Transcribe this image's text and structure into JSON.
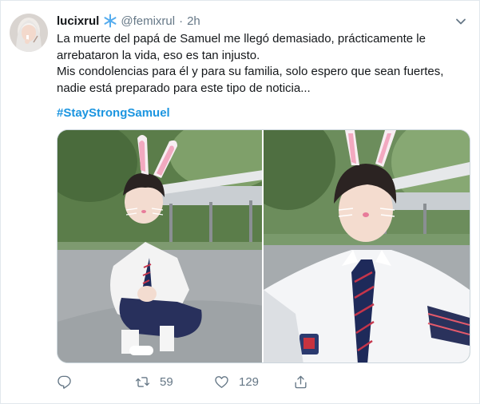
{
  "tweet": {
    "display_name": "lucixrul",
    "handle": "@femixrul",
    "separator": "·",
    "time": "2h",
    "text_lines": [
      "La muerte del papá de Samuel me llegó demasiado, prácticamente le",
      "arrebataron la vida, eso es tan injusto.",
      "Mis condolencias para él y para su familia, solo espero que sean fuertes,",
      "nadie está preparado para este tipo de noticia..."
    ],
    "hashtag": "#StayStrongSamuel",
    "media": [
      {
        "icon": "photo-boy-crouching-bunny-ears"
      },
      {
        "icon": "photo-boy-closeup-bunny-ears"
      }
    ],
    "actions": {
      "reply": {
        "icon": "reply-icon",
        "count": ""
      },
      "retweet": {
        "icon": "retweet-icon",
        "count": "59"
      },
      "like": {
        "icon": "heart-icon",
        "count": "129"
      },
      "share": {
        "icon": "share-icon",
        "count": ""
      }
    }
  },
  "colors": {
    "text": "#14171a",
    "muted": "#657786",
    "link": "#1b95e0",
    "border": "#e1e8ed"
  }
}
